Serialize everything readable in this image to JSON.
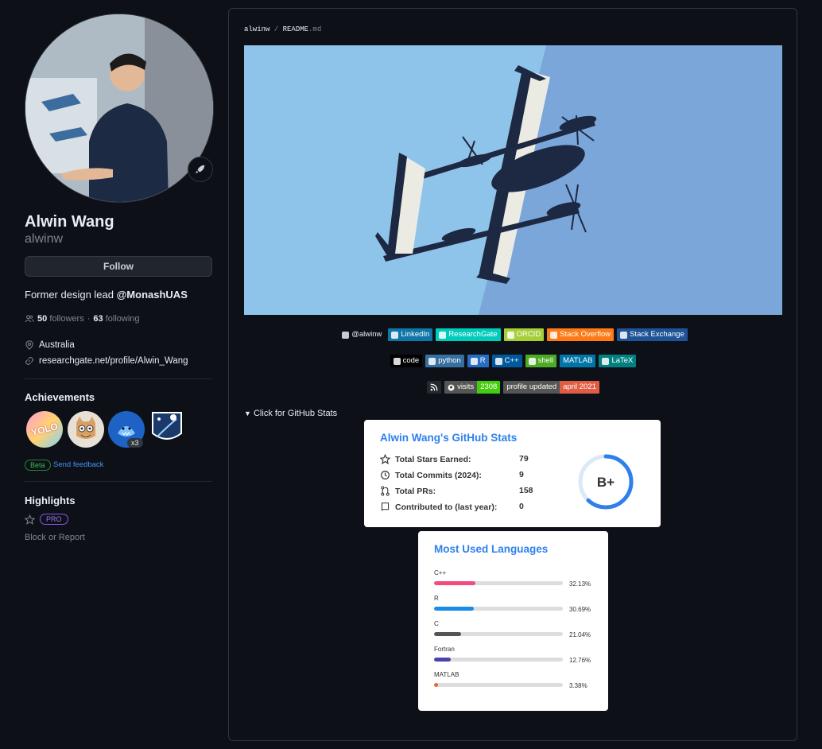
{
  "profile": {
    "name": "Alwin Wang",
    "login": "alwinw",
    "follow_label": "Follow",
    "bio_prefix": "Former design lead ",
    "bio_org": "@MonashUAS",
    "followers_count": "50",
    "followers_label": "followers",
    "separator": "·",
    "following_count": "63",
    "following_label": "following",
    "location": "Australia",
    "website": "researchgate.net/profile/Alwin_Wang"
  },
  "achievements": {
    "heading": "Achievements",
    "badges": [
      {
        "name": "yolo-badge",
        "label": "YOLO"
      },
      {
        "name": "cat-badge",
        "label": ""
      },
      {
        "name": "shark-badge",
        "label": "x3"
      },
      {
        "name": "rocket-badge",
        "label": ""
      }
    ],
    "beta_label": "Beta",
    "feedback_label": "Send feedback"
  },
  "highlights": {
    "heading": "Highlights",
    "pro_label": "PRO",
    "block_label": "Block or Report"
  },
  "readme": {
    "owner": "alwinw",
    "slash": "/",
    "file": "README",
    "ext": ".md",
    "details_label": "Click for GitHub Stats"
  },
  "shields_row1": [
    {
      "name": "github-shield",
      "label": "@alwinw",
      "bg": "transparent",
      "color": "#e6edf3",
      "icon": "github-icon"
    },
    {
      "name": "linkedin-shield",
      "label": "LinkedIn",
      "bg": "#0e76a8",
      "color": "#ffffff",
      "icon": "linkedin-icon"
    },
    {
      "name": "researchgate-shield",
      "label": "ResearchGate",
      "bg": "#00ccbb",
      "color": "#ffffff",
      "icon": "researchgate-icon"
    },
    {
      "name": "orcid-shield",
      "label": "ORCID",
      "bg": "#a6ce39",
      "color": "#ffffff",
      "icon": "orcid-icon"
    },
    {
      "name": "stackoverflow-shield",
      "label": "Stack Overflow",
      "bg": "#fe7a16",
      "color": "#ffffff",
      "icon": "stackoverflow-icon"
    },
    {
      "name": "stackexchange-shield",
      "label": "Stack Exchange",
      "bg": "#1e5397",
      "color": "#ffffff",
      "icon": "stackexchange-icon"
    }
  ],
  "shields_row2": [
    {
      "name": "code-shield",
      "label": "code",
      "bg": "#000000",
      "color": "#ffffff",
      "icon": "plex-icon"
    },
    {
      "name": "python-shield",
      "label": "python",
      "bg": "#3670a0",
      "color": "#ffffff",
      "icon": "python-icon"
    },
    {
      "name": "r-shield",
      "label": "R",
      "bg": "#276dc3",
      "color": "#ffffff",
      "icon": "r-icon"
    },
    {
      "name": "cpp-shield",
      "label": "C++",
      "bg": "#00599c",
      "color": "#ffffff",
      "icon": "cpp-icon"
    },
    {
      "name": "shell-shield",
      "label": "shell",
      "bg": "#4eaa25",
      "color": "#ffffff",
      "icon": "shell-icon"
    },
    {
      "name": "matlab-shield",
      "label": "MATLAB",
      "bg": "#0076a8",
      "color": "#ffffff",
      "icon": ""
    },
    {
      "name": "latex-shield",
      "label": "LaTeX",
      "bg": "#008080",
      "color": "#ffffff",
      "icon": "latex-icon"
    }
  ],
  "visits": {
    "label": "visits",
    "count": "2308",
    "updated_label": "profile updated",
    "updated_value": "april 2021"
  },
  "stats_card": {
    "title": "Alwin Wang's GitHub Stats",
    "rows": [
      {
        "label": "Total Stars Earned:",
        "value": "79",
        "icon": "star-icon"
      },
      {
        "label": "Total Commits (2024):",
        "value": "9",
        "icon": "history-icon"
      },
      {
        "label": "Total PRs:",
        "value": "158",
        "icon": "pr-icon"
      },
      {
        "label": "Contributed to (last year):",
        "value": "0",
        "icon": "repo-icon"
      }
    ],
    "rank": "B+",
    "rank_progress": 0.62
  },
  "languages_card": {
    "title": "Most Used Languages",
    "languages": [
      {
        "name": "C++",
        "percent_label": "32.13%",
        "percent": 32.13,
        "color": "#f34b7d"
      },
      {
        "name": "R",
        "percent_label": "30.69%",
        "percent": 30.69,
        "color": "#198ce7"
      },
      {
        "name": "C",
        "percent_label": "21.04%",
        "percent": 21.04,
        "color": "#555555"
      },
      {
        "name": "Fortran",
        "percent_label": "12.76%",
        "percent": 12.76,
        "color": "#4d41b1"
      },
      {
        "name": "MATLAB",
        "percent_label": "3.38%",
        "percent": 3.38,
        "color": "#e16737"
      }
    ]
  }
}
